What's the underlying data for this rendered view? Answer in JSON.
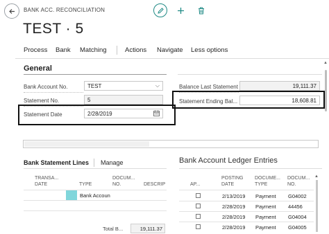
{
  "header": {
    "caption": "BANK ACC. RECONCILIATION",
    "back_icon": "arrow-left-icon",
    "edit_icon": "pencil-icon",
    "new_icon": "plus-icon",
    "delete_icon": "trash-icon",
    "accent_color": "#1f8a85"
  },
  "record_title": "TEST · 5",
  "actions": [
    "Process",
    "Bank",
    "Matching",
    "Actions",
    "Navigate",
    "Less options"
  ],
  "general": {
    "title": "General",
    "bank_account_no": {
      "label": "Bank Account No.",
      "value": "TEST"
    },
    "statement_no": {
      "label": "Statement No.",
      "value": "5"
    },
    "statement_date": {
      "label": "Statement Date",
      "value": "2/28/2019"
    },
    "balance_last_statement": {
      "label": "Balance Last Statement",
      "value": "19,111.37"
    },
    "statement_ending_balance": {
      "label": "Statement Ending Bal...",
      "value": "18,608.81"
    }
  },
  "bank_statement_lines": {
    "title": "Bank Statement Lines",
    "manage_label": "Manage",
    "columns": [
      {
        "line1": "TRANSA...",
        "line2": "DATE"
      },
      {
        "line1": "",
        "line2": "TYPE"
      },
      {
        "line1": "DOCUM...",
        "line2": "NO."
      },
      {
        "line1": "",
        "line2": "DESCRIP"
      }
    ],
    "rows": [
      {
        "date": "",
        "type": "Bank Accoun",
        "doc_no": "",
        "description": ""
      },
      {
        "date": "",
        "type": "",
        "doc_no": "",
        "description": ""
      }
    ],
    "total_label": "Total B...",
    "total_value": "19,111.37"
  },
  "ledger_entries": {
    "title": "Bank Account Ledger Entries",
    "columns": [
      {
        "line1": "",
        "line2": "AP..."
      },
      {
        "line1": "POSTING",
        "line2": "DATE"
      },
      {
        "line1": "DOCUME...",
        "line2": "TYPE"
      },
      {
        "line1": "DOCUM...",
        "line2": "NO."
      }
    ],
    "rows": [
      {
        "applied": false,
        "posting_date": "2/13/2019",
        "doc_type": "Payment",
        "doc_no": "G04002"
      },
      {
        "applied": false,
        "posting_date": "2/28/2019",
        "doc_type": "Payment",
        "doc_no": "44456"
      },
      {
        "applied": false,
        "posting_date": "2/28/2019",
        "doc_type": "Payment",
        "doc_no": "G04004"
      },
      {
        "applied": false,
        "posting_date": "2/28/2019",
        "doc_type": "Payment",
        "doc_no": "G04005"
      }
    ]
  }
}
